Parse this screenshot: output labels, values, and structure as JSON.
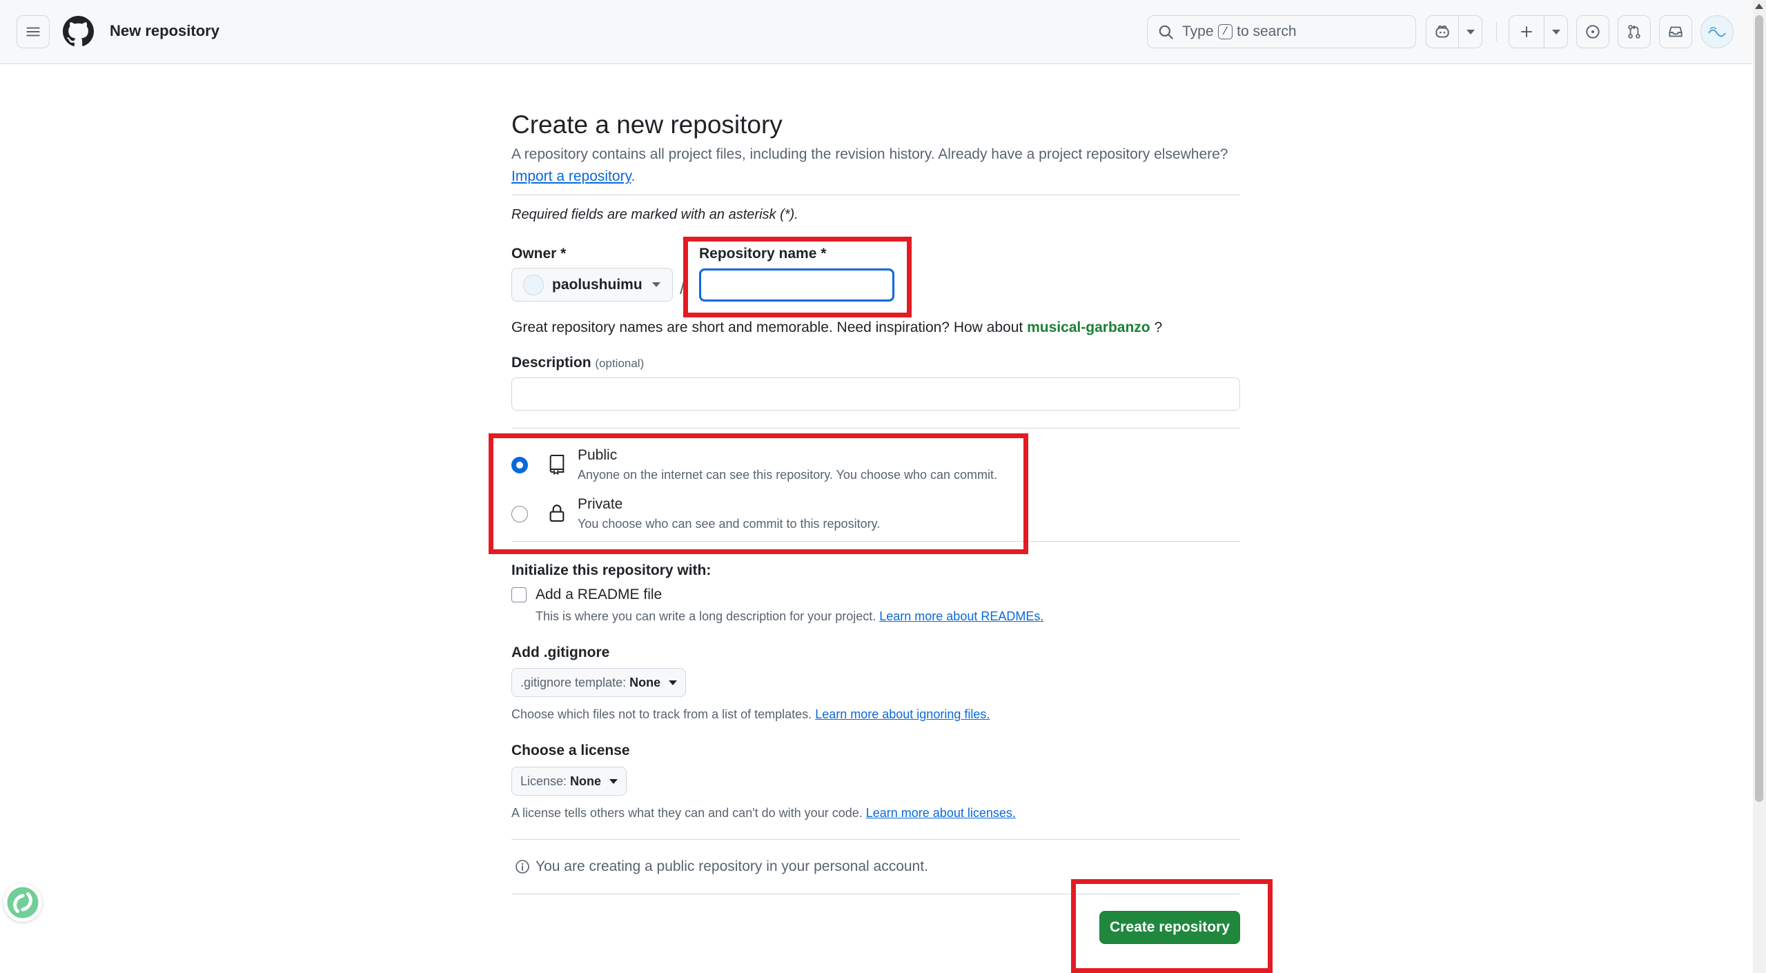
{
  "header": {
    "context_title": "New repository",
    "search": {
      "prefix": "Type",
      "key": "/",
      "suffix": "to search"
    }
  },
  "form": {
    "heading": "Create a new repository",
    "subtitle": "A repository contains all project files, including the revision history. Already have a project repository elsewhere?",
    "import_link": "Import a repository",
    "import_period": ".",
    "required_note": "Required fields are marked with an asterisk (*).",
    "owner": {
      "label": "Owner *",
      "value": "paolushuimu"
    },
    "separator": "/",
    "repo_name": {
      "label": "Repository name *",
      "value": ""
    },
    "inspiration": {
      "text": "Great repository names are short and memorable. Need inspiration? How about",
      "suggestion": "musical-garbanzo",
      "end": "?"
    },
    "description": {
      "label": "Description",
      "optional": "(optional)",
      "value": ""
    },
    "visibility": {
      "selected": "public",
      "options": [
        {
          "id": "public",
          "title": "Public",
          "desc": "Anyone on the internet can see this repository. You choose who can commit."
        },
        {
          "id": "private",
          "title": "Private",
          "desc": "You choose who can see and commit to this repository."
        }
      ]
    },
    "initialize": {
      "label": "Initialize this repository with:",
      "readme_label": "Add a README file",
      "readme_checked": false,
      "readme_help": "This is where you can write a long description for your project.",
      "readme_link": "Learn more about READMEs."
    },
    "gitignore": {
      "label": "Add .gitignore",
      "button_prefix": ".gitignore template:",
      "button_value": "None",
      "help": "Choose which files not to track from a list of templates.",
      "link": "Learn more about ignoring files."
    },
    "license": {
      "label": "Choose a license",
      "button_prefix": "License:",
      "button_value": "None",
      "help": "A license tells others what they can and can't do with your code.",
      "link": "Learn more about licenses."
    },
    "info": "You are creating a public repository in your personal account.",
    "submit_label": "Create repository"
  },
  "colors": {
    "accent": "#0969da",
    "primary_button": "#1f883d",
    "suggestion": "#1a7f37",
    "annotation": "#e31b23"
  },
  "icons": [
    "hamburger-icon",
    "github-logo-icon",
    "search-icon",
    "copilot-icon",
    "chevron-down-icon",
    "plus-icon",
    "issues-icon",
    "pull-request-icon",
    "inbox-icon",
    "repo-icon",
    "lock-icon",
    "info-icon"
  ]
}
